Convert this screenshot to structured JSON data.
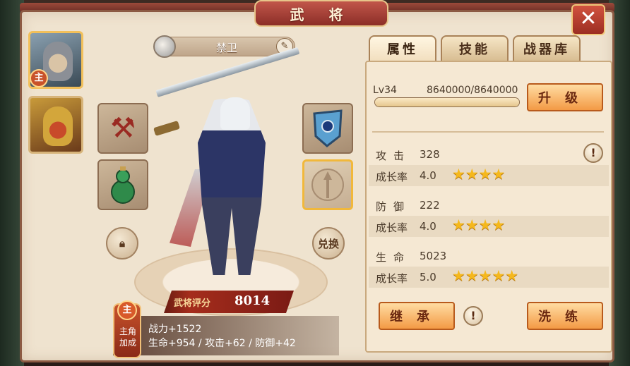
{
  "title": "武 将",
  "close_label": "✕",
  "heroes": {
    "main_badge": "主"
  },
  "hero_name": "禁卫",
  "unlock_label": "兑换",
  "score": {
    "label": "武将评分",
    "value": "8014"
  },
  "bonus": {
    "badge": "主",
    "badge_text": "主角加成",
    "line1": "战力+1522",
    "line2": "生命+954 / 攻击+62 / 防御+42"
  },
  "tabs": [
    {
      "label": "属性"
    },
    {
      "label": "技能"
    },
    {
      "label": "战器库"
    }
  ],
  "level": {
    "label": "Lv34",
    "exp": "8640000/8640000",
    "progress": 1.0
  },
  "upgrade_label": "升级",
  "stats": [
    {
      "name": "攻击",
      "value": "328",
      "growth_label": "成长率",
      "growth": "4.0",
      "stars": "★★★★"
    },
    {
      "name": "防御",
      "value": "222",
      "growth_label": "成长率",
      "growth": "4.0",
      "stars": "★★★★"
    },
    {
      "name": "生命",
      "value": "5023",
      "growth_label": "成长率",
      "growth": "5.0",
      "stars": "★★★★★"
    }
  ],
  "inherit_label": "继承",
  "refine_label": "洗练",
  "info_label": "!",
  "colors": {
    "accent": "#f39a45",
    "panel": "#efe3cf",
    "star": "#f5b81c"
  }
}
